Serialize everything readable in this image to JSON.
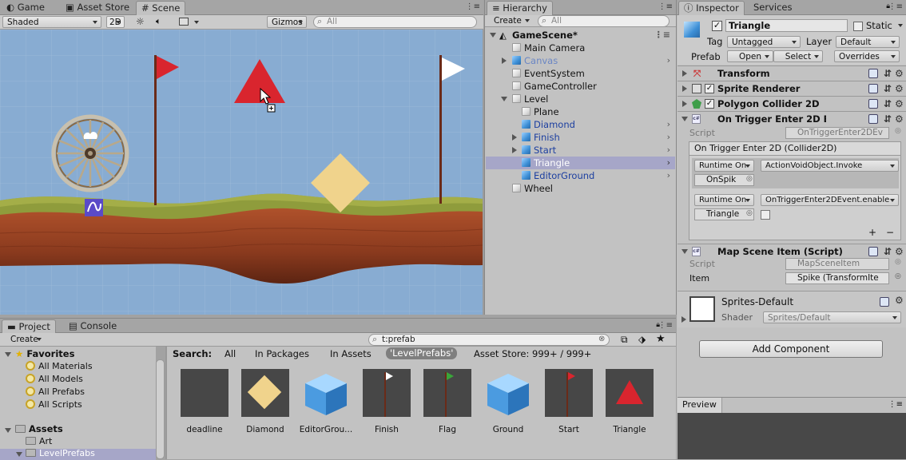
{
  "scene_tabs": {
    "game": "Game",
    "asset_store": "Asset Store",
    "scene": "Scene"
  },
  "scene_toolbar": {
    "shading": "Shaded",
    "mode_2d": "2D",
    "gizmos": "Gizmos",
    "search_placeholder": "All"
  },
  "hierarchy": {
    "tab": "Hierarchy",
    "create": "Create",
    "search_placeholder": "All",
    "scene_name": "GameScene*",
    "items": [
      "Main Camera",
      "Canvas",
      "EventSystem",
      "GameController",
      "Level",
      "Plane",
      "Diamond",
      "Finish",
      "Start",
      "Triangle",
      "EditorGround",
      "Wheel"
    ]
  },
  "inspector": {
    "tab_inspector": "Inspector",
    "tab_services": "Services",
    "object_name": "Triangle",
    "static_label": "Static",
    "tag_label": "Tag",
    "tag_value": "Untagged",
    "layer_label": "Layer",
    "layer_value": "Default",
    "prefab_label": "Prefab",
    "open": "Open",
    "select": "Select",
    "overrides": "Overrides",
    "components": {
      "transform": "Transform",
      "sprite_renderer": "Sprite Renderer",
      "polygon_collider": "Polygon Collider 2D",
      "on_trigger": "On Trigger Enter 2D Even",
      "map_scene_item": "Map Scene Item (Script)"
    },
    "script_label": "Script",
    "script_value_1": "OnTriggerEnter2DEv",
    "event_title": "On Trigger Enter 2D (Collider2D)",
    "event1_mode": "Runtime On",
    "event1_func": "ActionVoidObject.Invoke",
    "event1_obj": "OnSpik",
    "event2_mode": "Runtime On",
    "event2_func": "OnTriggerEnter2DEvent.enable",
    "event2_obj": "Triangle",
    "plus": "+",
    "minus": "−",
    "script_value_2": "MapSceneItem",
    "item_label": "Item",
    "item_value": "Spike (TransformIte",
    "material_name": "Sprites-Default",
    "shader_label": "Shader",
    "shader_value": "Sprites/Default",
    "add_component": "Add Component",
    "preview": "Preview"
  },
  "project": {
    "tab_project": "Project",
    "tab_console": "Console",
    "create": "Create",
    "search_value": "t:prefab",
    "favorites": "Favorites",
    "fav_items": [
      "All Materials",
      "All Models",
      "All Prefabs",
      "All Scripts"
    ],
    "assets": "Assets",
    "asset_folders": [
      "Art",
      "LevelPrefabs"
    ],
    "search_label": "Search:",
    "filter_all": "All",
    "filter_packages": "In Packages",
    "filter_assets": "In Assets",
    "filter_levelprefabs": "'LevelPrefabs'",
    "filter_store": "Asset Store: 999+ / 999+",
    "prefabs": [
      "deadline",
      "Diamond",
      "EditorGrou...",
      "Finish",
      "Flag",
      "Ground",
      "Start",
      "Triangle"
    ]
  },
  "colors": {
    "sky": "#88acd2",
    "selection": "#a6a6c8",
    "triangle_red": "#d9252e",
    "diamond": "#f0d38c"
  }
}
